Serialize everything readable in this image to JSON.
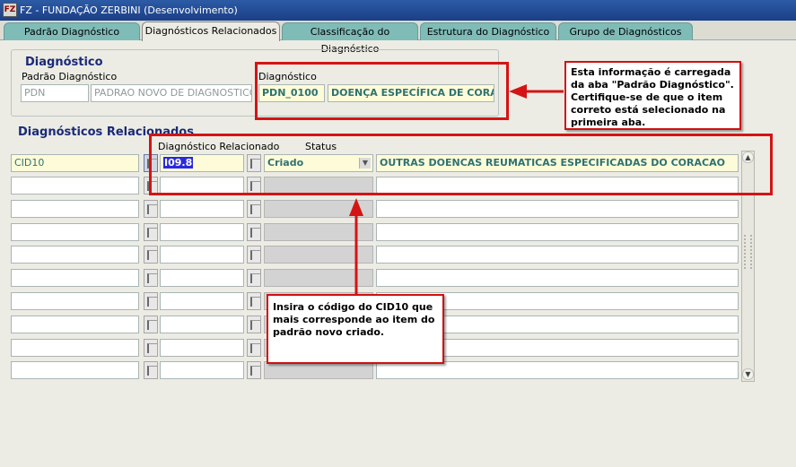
{
  "window": {
    "title": "FZ - FUNDAÇÃO ZERBINI (Desenvolvimento)",
    "icon": "app-logo-icon"
  },
  "tabs": [
    {
      "label": "Padrão Diagnóstico",
      "active": false
    },
    {
      "label": "Diagnósticos Relacionados",
      "active": true
    },
    {
      "label": "Classificação do Diagnóstico",
      "active": false
    },
    {
      "label": "Estrutura do Diagnóstico",
      "active": false
    },
    {
      "label": "Grupo de Diagnósticos",
      "active": false
    }
  ],
  "diagnostico": {
    "section_title": "Diagnóstico",
    "padrao_label": "Padrão Diagnóstico",
    "padrao_code": "PDN",
    "padrao_desc": "PADRAO NOVO DE DIAGNOSTICOS",
    "diag_label": "Diagnóstico",
    "diag_code": "PDN_0100",
    "diag_desc": "DOENÇA ESPECÍFICA DE CORAÇÃO"
  },
  "relacionados": {
    "section_title": "Diagnósticos Relacionados",
    "col_diag_relacionado": "Diagnóstico Relacionado",
    "col_status": "Status",
    "first_row": {
      "tipo": "CID10",
      "codigo": "I09.8",
      "status": "Criado",
      "descricao": "OUTRAS DOENCAS REUMATICAS ESPECIFICADAS DO CORACAO"
    }
  },
  "callouts": {
    "top": "Esta informação é carregada da aba \"Padrão Diagnóstico\". Certifique-se de que o item correto está selecionado na primeira aba.",
    "bottom": "Insira o código do CID10 que mais corresponde ao item do padrão novo criado."
  },
  "colors": {
    "titlebar": "#1b3f86",
    "tab": "#7fbcb8",
    "annotation": "#d41414",
    "section_title": "#1a2a78"
  }
}
